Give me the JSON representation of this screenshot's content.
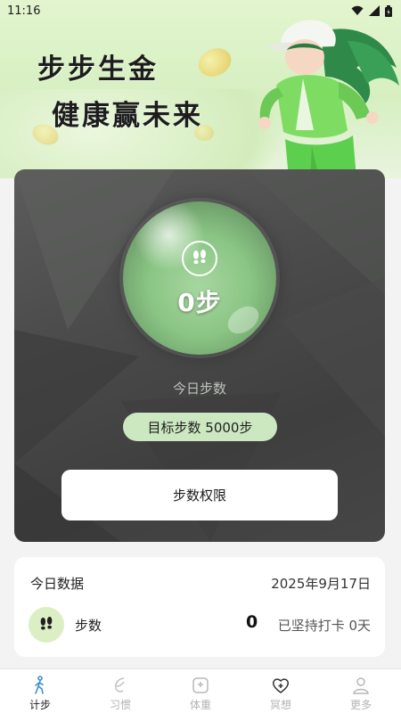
{
  "status_bar": {
    "time": "11:16"
  },
  "hero": {
    "slogan_line1": "步步生金",
    "slogan_line2": "健康赢未来"
  },
  "step_card": {
    "step_count": "0步",
    "today_label": "今日步数",
    "goal_label": "目标步数 5000步",
    "permission_button": "步数权限",
    "progress_fraction": 0
  },
  "today_data": {
    "title": "今日数据",
    "date": "2025年9月17日",
    "steps_label": "步数",
    "steps_value": "0",
    "streak_label": "已坚持打卡 0天"
  },
  "bottom_nav": {
    "items": [
      {
        "label": "计步",
        "icon": "walker-icon",
        "active": true
      },
      {
        "label": "习惯",
        "icon": "leaf-icon",
        "active": false
      },
      {
        "label": "体重",
        "icon": "scale-icon",
        "active": false
      },
      {
        "label": "冥想",
        "icon": "heart-plus-icon",
        "active": false
      },
      {
        "label": "更多",
        "icon": "person-icon",
        "active": false
      }
    ]
  },
  "colors": {
    "accent_green": "#8ac584",
    "pill_green": "#cbe8c0",
    "card_dark": "#4b4c4b",
    "icon_bg": "#dcefc4"
  }
}
